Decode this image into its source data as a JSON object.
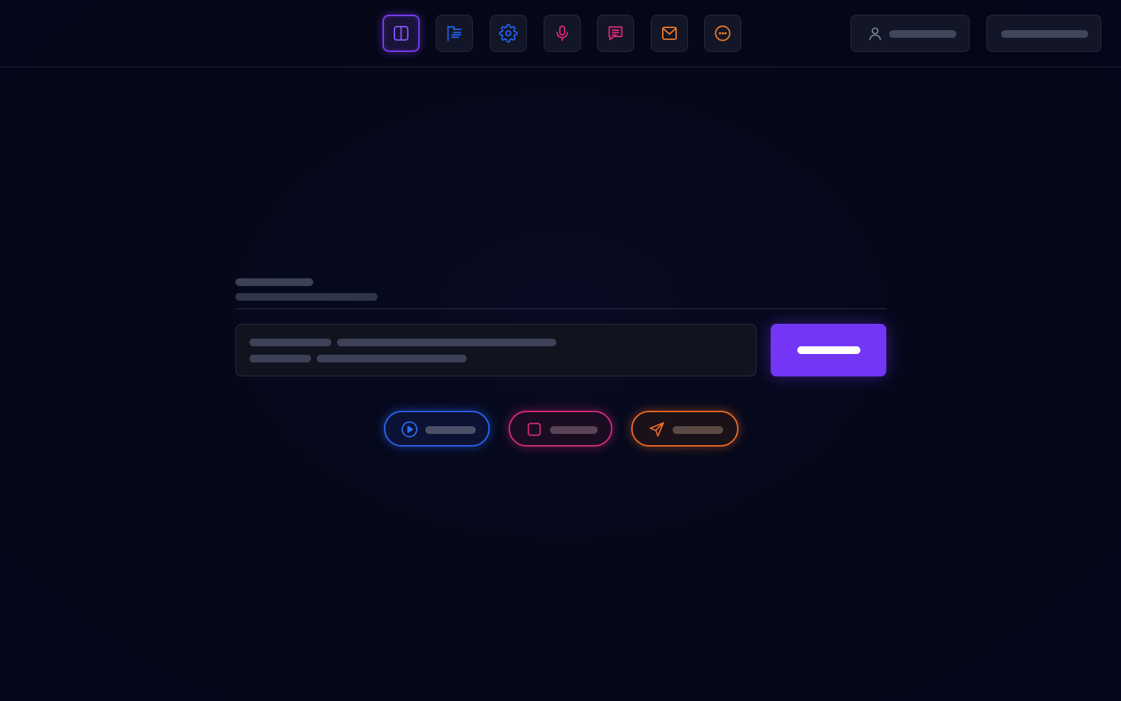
{
  "toolbar": {
    "tools": [
      {
        "icon": "split-view-icon",
        "active": true,
        "color": "#7b3cf5"
      },
      {
        "icon": "flag-list-icon",
        "color": "#2563eb"
      },
      {
        "icon": "gear-icon",
        "color": "#2563eb"
      },
      {
        "icon": "microphone-icon",
        "color": "#e0287a"
      },
      {
        "icon": "chat-message-icon",
        "color": "#e0287a"
      },
      {
        "icon": "mail-icon",
        "color": "#f07a22"
      },
      {
        "icon": "more-options-icon",
        "color": "#f07a22"
      }
    ],
    "account": {
      "icon": "user-icon",
      "label": ""
    },
    "right_button_label": ""
  },
  "main": {
    "heading": "",
    "subheading": "",
    "prompt": {
      "line1_a": "",
      "line1_b": "",
      "line2_a": "",
      "line2_b": ""
    },
    "primary_button_label": "",
    "actions": [
      {
        "icon": "play-icon",
        "label": "",
        "color": "#2b63f0"
      },
      {
        "icon": "stop-icon",
        "label": "",
        "color": "#d62a78"
      },
      {
        "icon": "send-icon",
        "label": "",
        "color": "#ed6a25"
      }
    ]
  },
  "colors": {
    "background": "#050717",
    "accent": "#7436f6"
  }
}
